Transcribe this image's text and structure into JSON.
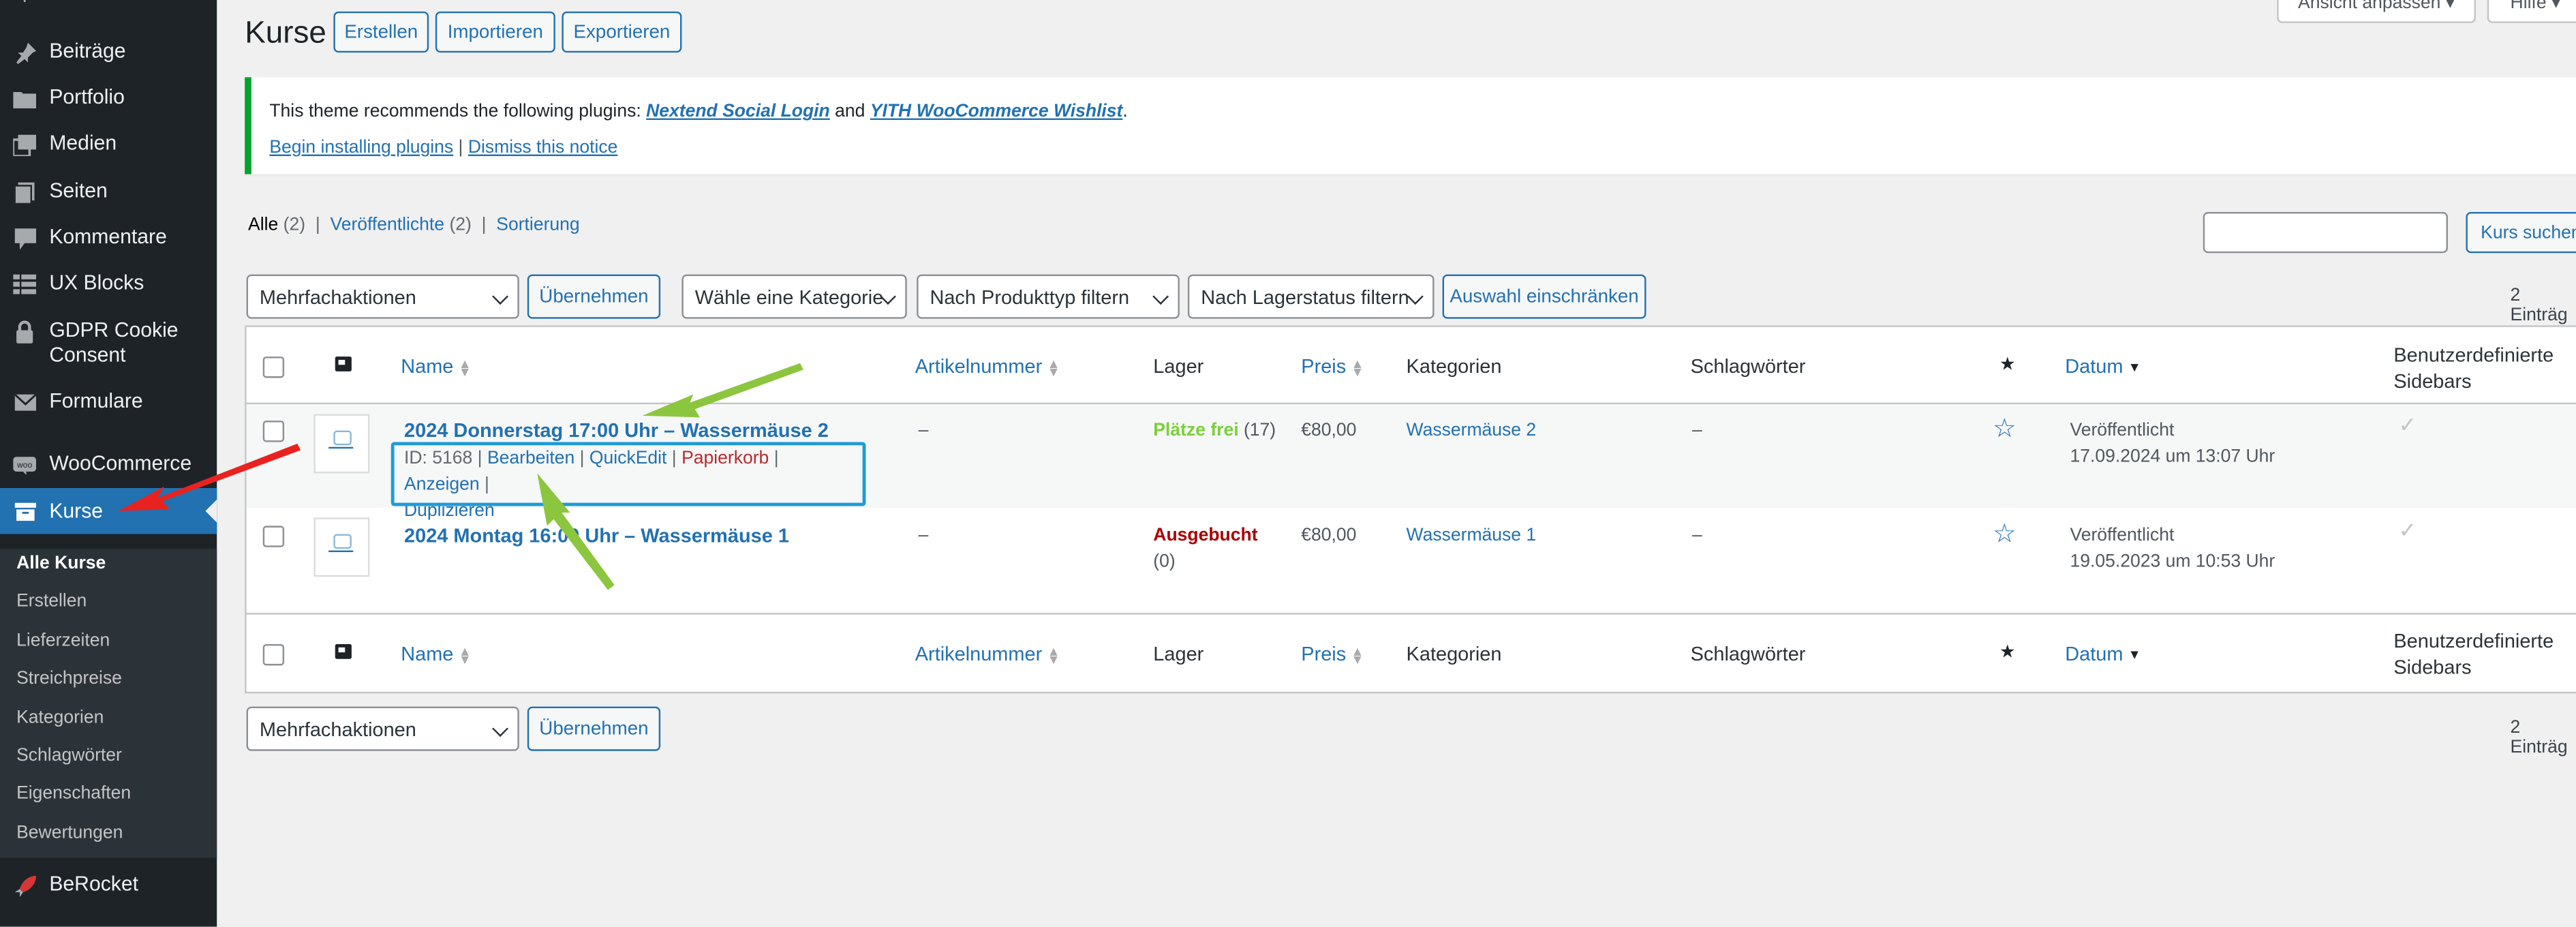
{
  "sidebar": {
    "items": [
      {
        "label": "Beiträge",
        "icon": "pushpin-icon"
      },
      {
        "label": "Portfolio",
        "icon": "folder-icon"
      },
      {
        "label": "Medien",
        "icon": "media-icon"
      },
      {
        "label": "Seiten",
        "icon": "page-icon"
      },
      {
        "label": "Kommentare",
        "icon": "comment-icon"
      },
      {
        "label": "UX Blocks",
        "icon": "blocks-icon"
      },
      {
        "label": "GDPR Cookie",
        "label2": "Consent",
        "icon": "lock-icon"
      },
      {
        "label": "Formulare",
        "icon": "envelope-icon"
      },
      {
        "label": "WooCommerce",
        "icon": "woo-icon"
      },
      {
        "label": "Kurse",
        "icon": "archive-icon"
      },
      {
        "label": "BeRocket",
        "icon": "rocket-icon"
      }
    ],
    "submenu": [
      "Alle Kurse",
      "Erstellen",
      "Lieferzeiten",
      "Streichpreise",
      "Kategorien",
      "Schlagwörter",
      "Eigenschaften",
      "Bewertungen"
    ]
  },
  "header": {
    "title": "Kurse",
    "buttons": [
      "Erstellen",
      "Importieren",
      "Exportieren"
    ],
    "screen_options": "Ansicht anpassen",
    "help": "Hilfe"
  },
  "notice": {
    "prefix": "This theme recommends the following plugins:",
    "plugin1": "Nextend Social Login",
    "and": "and",
    "plugin2": "YITH WooCommerce Wishlist",
    "suffix": ".",
    "begin": "Begin installing plugins",
    "divider": "|",
    "dismiss": "Dismiss this notice"
  },
  "views": {
    "all": "Alle",
    "all_count": "(2)",
    "published": "Veröffentlichte",
    "published_count": "(2)",
    "sorting": "Sortierung",
    "sep": "|"
  },
  "search": {
    "value": "",
    "button": "Kurs suchen"
  },
  "filters": {
    "bulk": "Mehrfachaktionen",
    "apply": "Übernehmen",
    "category": "Wähle eine Kategorie",
    "product_type": "Nach Produkttyp filtern",
    "stock": "Nach Lagerstatus filtern",
    "filter_btn": "Auswahl einschränken",
    "count": "2 Einträg"
  },
  "columns": {
    "name": "Name",
    "sku": "Artikelnummer",
    "stock": "Lager",
    "price": "Preis",
    "categories": "Kategorien",
    "tags": "Schlagwörter",
    "date": "Datum",
    "sidebars1": "Benutzerdefinierte",
    "sidebars2": "Sidebars"
  },
  "rows": [
    {
      "title": "2024 Donnerstag 17:00 Uhr – Wassermäuse 2",
      "id": "ID: 5168",
      "edit": "Bearbeiten",
      "quickedit": "QuickEdit",
      "trash": "Papierkorb",
      "view": "Anzeigen",
      "duplicate": "Duplizieren",
      "sku": "–",
      "stock": "Plätze frei",
      "stock_count": "(17)",
      "price": "€80,00",
      "category": "Wassermäuse 2",
      "tags": "–",
      "date_status": "Veröffentlicht",
      "date": "17.09.2024 um 13:07 Uhr"
    },
    {
      "title": "2024 Montag 16:00 Uhr – Wassermäuse 1",
      "sku": "–",
      "stock": "Ausgebucht",
      "stock_count": "(0)",
      "price": "€80,00",
      "category": "Wassermäuse 1",
      "tags": "–",
      "date_status": "Veröffentlicht",
      "date": "19.05.2023 um 10:53 Uhr"
    }
  ],
  "colors": {
    "accent": "#2271b1",
    "sidebar": "#1d2327",
    "notice": "#00a32a",
    "annotation_arrow_red": "#e8231f",
    "annotation_arrow_green": "#8cc63f",
    "highlight": "#1e9bd7"
  }
}
